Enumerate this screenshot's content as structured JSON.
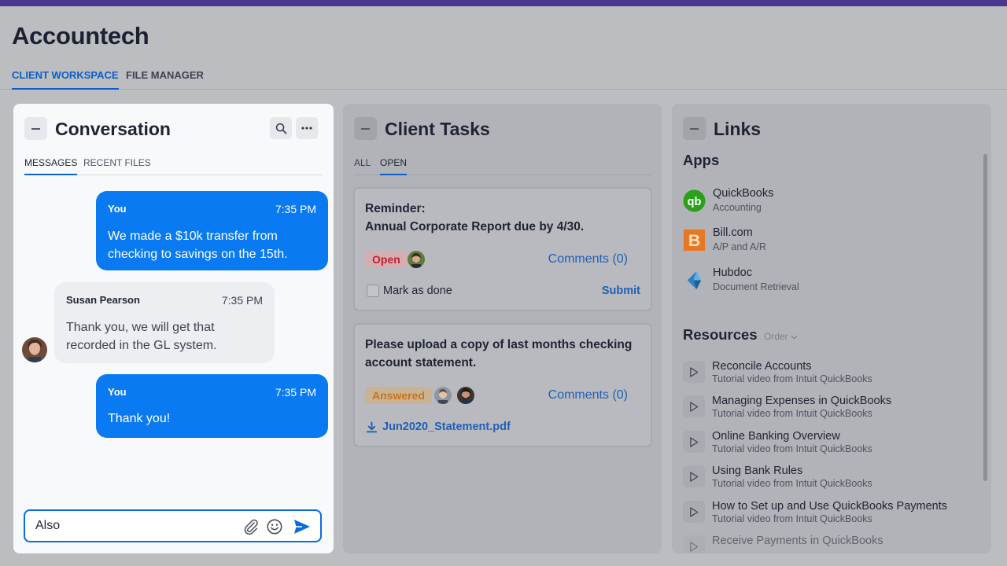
{
  "app": {
    "title": "Accountech"
  },
  "main_tabs": [
    {
      "label": "CLIENT WORKSPACE",
      "active": true
    },
    {
      "label": "FILE MANAGER",
      "active": false
    }
  ],
  "conversation": {
    "title": "Conversation",
    "tabs": [
      {
        "label": "MESSAGES",
        "active": true
      },
      {
        "label": "RECENT FILES",
        "active": false
      }
    ],
    "messages": [
      {
        "sender": "You",
        "time": "7:35 PM",
        "text": "We made a $10k transfer from checking to savings on the 15th."
      },
      {
        "sender": "Susan Pearson",
        "time": "7:35 PM",
        "text": "Thank you, we will get that recorded in the GL system."
      },
      {
        "sender": "You",
        "time": "7:35 PM",
        "text": "Thank you!"
      }
    ],
    "compose": {
      "value": "Also",
      "placeholder": ""
    }
  },
  "tasks": {
    "title": "Client Tasks",
    "tabs": [
      {
        "label": "ALL",
        "active": false
      },
      {
        "label": "OPEN",
        "active": true
      }
    ],
    "cards": [
      {
        "line1": "Reminder:",
        "line2": "Annual Corporate Report due by 4/30.",
        "status": "Open",
        "comments": "Comments (0)",
        "mark_done": "Mark as done",
        "submit": "Submit"
      },
      {
        "line1": "Please upload a copy of last months checking",
        "line2": "account statement.",
        "status": "Answered",
        "comments": "Comments (0)",
        "file": "Jun2020_Statement.pdf"
      }
    ]
  },
  "links": {
    "title": "Links",
    "apps_heading": "Apps",
    "apps": [
      {
        "name": "QuickBooks",
        "sub": "Accounting",
        "icon": "quickbooks-logo",
        "color": "#2ca01c"
      },
      {
        "name": "Bill.com",
        "sub": "A/P and A/R",
        "icon": "billcom-logo",
        "color": "#e87722"
      },
      {
        "name": "Hubdoc",
        "sub": "Document Retrieval",
        "icon": "hubdoc-logo",
        "color": "#2b80c4"
      }
    ],
    "resources_heading": "Resources",
    "order_label": "Order",
    "resources": [
      {
        "name": "Reconcile Accounts",
        "sub": "Tutorial video from Intuit QuickBooks"
      },
      {
        "name": "Managing Expenses in QuickBooks",
        "sub": "Tutorial video from Intuit QuickBooks"
      },
      {
        "name": "Online Banking Overview",
        "sub": "Tutorial video from Intuit QuickBooks"
      },
      {
        "name": "Using Bank Rules",
        "sub": "Tutorial video from Intuit QuickBooks"
      },
      {
        "name": "How to Set up and Use QuickBooks Payments",
        "sub": "Tutorial video from Intuit QuickBooks"
      },
      {
        "name": "Receive Payments in QuickBooks",
        "sub": ""
      }
    ]
  },
  "colors": {
    "accent": "#0a7af3",
    "brand_bar": "#4a3691",
    "link": "#1f5fb7"
  }
}
